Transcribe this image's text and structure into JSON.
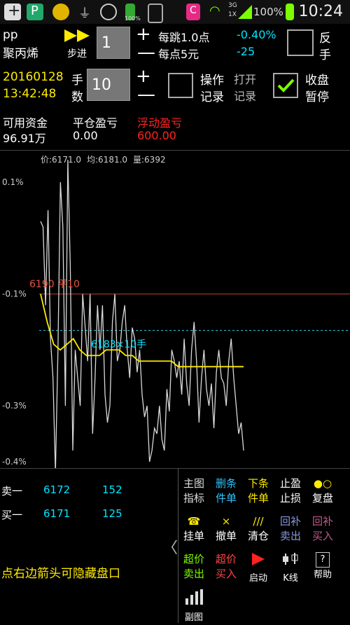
{
  "status_bar": {
    "time": "10:24",
    "battery": "100%",
    "signal_label": "3G",
    "signal_sub": "1X",
    "battery_small": "100%"
  },
  "ticker": {
    "code": "pp",
    "name": "聚丙烯",
    "step_label": "步进",
    "step_value": "1",
    "per_tick": "每跳1.0点",
    "per_point": "每点5元",
    "change_pct": "-0.40%",
    "change_val": "-25",
    "reverse_l1": "反",
    "reverse_l2": "手"
  },
  "order": {
    "date": "20160128",
    "time": "13:42:48",
    "lots_l1": "手",
    "lots_l2": "数",
    "lots_value": "10",
    "op_log_l1": "操作",
    "op_log_l2": "记录",
    "open_log_l1": "打开",
    "open_log_l2": "记录",
    "close_pause_l1": "收盘",
    "close_pause_l2": "暂停"
  },
  "account": {
    "avail_label": "可用资金",
    "avail_value": "96.91万",
    "close_pl_label": "平仓盈亏",
    "close_pl_value": "0.00",
    "float_pl_label": "浮动盈亏",
    "float_pl_value": "600.00"
  },
  "chart_info": {
    "price_label": "价:6171.0",
    "avg_label": "均:6181.0",
    "vol_label": "量:6392",
    "open_line_label": "6190 平10",
    "avg_line_label": "6183×10手"
  },
  "chart_data": {
    "type": "line",
    "y_ticks": [
      "0.1%",
      "-0.1%",
      "-0.3%",
      "-0.4%"
    ],
    "series": [
      {
        "values": [
          0.03,
          0.02,
          -0.12,
          0.05,
          -0.18,
          -0.25,
          -0.42,
          -0.2,
          0.1,
          0.02,
          -0.3,
          0.14,
          -0.05,
          -0.38,
          -0.2,
          -0.25,
          -0.3,
          -0.1,
          -0.16,
          -0.22,
          -0.1,
          -0.35,
          -0.25,
          -0.12,
          -0.2,
          -0.12,
          -0.28,
          -0.33,
          -0.3,
          -0.15,
          -0.1,
          -0.22,
          -0.2,
          -0.15,
          -0.12,
          -0.2,
          -0.25,
          -0.16,
          -0.18,
          -0.24,
          -0.2,
          -0.28,
          -0.32,
          -0.3,
          -0.4,
          -0.38,
          -0.34,
          -0.35,
          -0.3,
          -0.36,
          -0.38,
          -0.27,
          -0.31,
          -0.2,
          -0.22,
          -0.25,
          -0.22,
          -0.28,
          -0.18,
          -0.26,
          -0.3,
          -0.2,
          -0.15,
          -0.22,
          -0.33,
          -0.25,
          -0.2,
          -0.27,
          -0.3,
          -0.26,
          -0.34,
          -0.24,
          -0.2,
          -0.25,
          -0.26,
          -0.3,
          -0.22,
          -0.18,
          -0.25,
          -0.3,
          -0.35,
          -0.33,
          -0.38
        ]
      },
      {
        "values": [
          -0.1,
          -0.15,
          -0.19,
          -0.2,
          -0.19,
          -0.18,
          -0.2,
          -0.21,
          -0.21,
          -0.21,
          -0.2,
          -0.2,
          -0.2,
          -0.21,
          -0.21,
          -0.22,
          -0.22,
          -0.22,
          -0.22,
          -0.22,
          -0.22,
          -0.23,
          -0.23,
          -0.23,
          -0.23,
          -0.23,
          -0.23,
          -0.23,
          -0.23,
          -0.23,
          -0.23,
          -0.23
        ]
      }
    ],
    "price_line_pct": -0.1,
    "avg_line_pct": -0.165,
    "ylim": [
      -0.4,
      0.1
    ]
  },
  "quotes": {
    "ask_label": "卖一",
    "ask_price": "6172",
    "ask_vol": "152",
    "bid_label": "买一",
    "bid_price": "6171",
    "bid_vol": "125",
    "tip": "点右边箭头可隐藏盘口"
  },
  "buttons": {
    "main_ind_l1": "主图",
    "main_ind_l2": "指标",
    "del_cond_l1": "删条",
    "del_cond_l2": "件单",
    "place_cond_l1": "下条",
    "place_cond_l2": "件单",
    "tp_l1": "止盈",
    "tp_l2": "止损",
    "replay_l2": "复盘",
    "hang": "挂单",
    "cancel": "撤单",
    "clear": "清仓",
    "rev_sell_l1": "回补",
    "rev_sell_l2": "卖出",
    "rev_buy_l1": "回补",
    "rev_buy_l2": "买入",
    "super_sell_l1": "超价",
    "super_sell_l2": "卖出",
    "super_buy_l1": "超价",
    "super_buy_l2": "买入",
    "start": "启动",
    "kline": "K线",
    "help": "帮助",
    "sub_chart": "副图"
  }
}
